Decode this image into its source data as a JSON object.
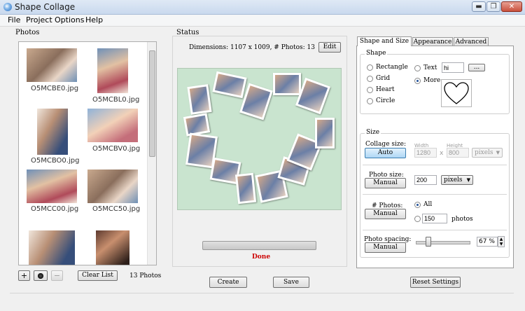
{
  "window": {
    "title": "Shape Collage",
    "min": "▬",
    "max": "❐",
    "close": "✕"
  },
  "menu": [
    "File",
    "Project",
    "Options",
    "Help"
  ],
  "photos": {
    "label": "Photos",
    "items": [
      {
        "name": "O5MCBE0.jpg"
      },
      {
        "name": "O5MCBL0.jpg"
      },
      {
        "name": "O5MCBO0.jpg"
      },
      {
        "name": "O5MCBV0.jpg"
      },
      {
        "name": "O5MCC00.jpg"
      },
      {
        "name": "O5MCC50.jpg"
      },
      {
        "name": ""
      },
      {
        "name": ""
      }
    ],
    "add": "+",
    "remove": "−",
    "clear": "Clear List",
    "count": "13 Photos"
  },
  "status": {
    "label": "Status",
    "dimensions": "Dimensions: 1107 x 1009, # Photos: 13",
    "edit": "Edit",
    "done": "Done",
    "progress": 0
  },
  "actions": {
    "create": "Create",
    "save": "Save",
    "reset": "Reset Settings"
  },
  "tabs": [
    "Shape and Size",
    "Appearance",
    "Advanced"
  ],
  "shape": {
    "legend": "Shape",
    "options": [
      "Rectangle",
      "Grid",
      "Heart",
      "Circle"
    ],
    "text_label": "Text",
    "text_value": "hi",
    "browse": "...",
    "more_label": "More",
    "selected": "More"
  },
  "size": {
    "legend": "Size",
    "collage_label": "Collage size:",
    "collage_mode": "Auto",
    "width_label": "Width",
    "width": "1280",
    "x": "x",
    "height_label": "Height",
    "height": "800",
    "units_disabled": "pixels",
    "photo_size_label": "Photo size:",
    "photo_size_mode": "Manual",
    "photo_size": "200",
    "photo_units": "pixels",
    "photos_label": "# Photos:",
    "photos_mode": "Manual",
    "all_label": "All",
    "photos_count": "150",
    "photos_suffix": "photos",
    "spacing_label": "Photo spacing:",
    "spacing_mode": "Manual",
    "spacing_value": "67",
    "spacing_unit": "%",
    "spacing_fraction": 0.2
  },
  "colors": {
    "done": "#cc0000",
    "canvas": "#c9e4cf"
  }
}
